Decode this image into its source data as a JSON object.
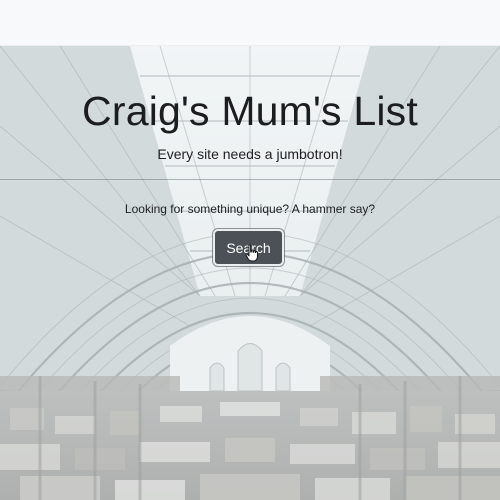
{
  "jumbotron": {
    "title": "Craig's Mum's List",
    "lead": "Every site needs a jumbotron!",
    "prompt": "Looking for something unique? A hammer say?",
    "search_label": "Search"
  },
  "background_image": "covered-market-hall-photo",
  "cursor_icon": "hand-pointer-icon",
  "colors": {
    "navbar": "#f8f9fa",
    "button": "#4b5156",
    "button_text": "#ffffff",
    "title_text": "#1b1d1f"
  }
}
